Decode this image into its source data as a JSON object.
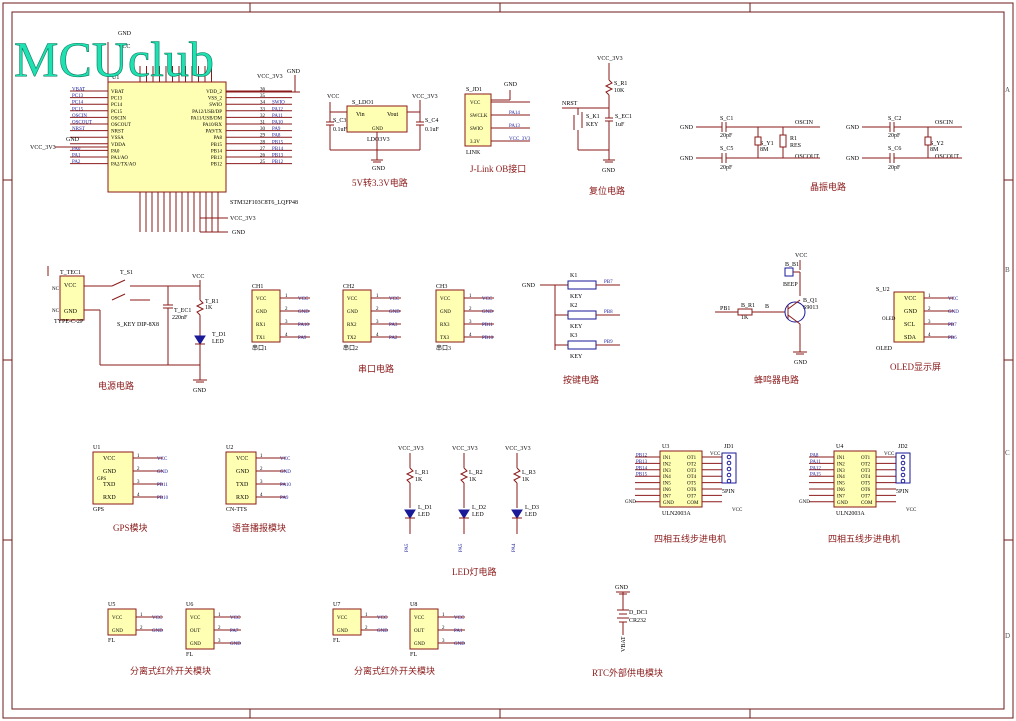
{
  "logo": "MCUclub",
  "border_marks": {
    "rows": [
      "A",
      "B",
      "C",
      "D"
    ]
  },
  "mcu": {
    "ref": "U1",
    "part": "STM32F103C8T6_LQFP48",
    "left_pins": [
      "VBAT",
      "PC13",
      "PC14",
      "PC15",
      "OSCIN",
      "OSCOUT",
      "NRST",
      "VSSA",
      "VDDA",
      "PA0",
      "PA1/AO",
      "PA2/TX/AO"
    ],
    "left_nets": [
      "VBAT",
      "PC13",
      "PC14",
      "PC15",
      "OSCIN",
      "OSCOUT",
      "NRST",
      "",
      "",
      "PA0",
      "PA1",
      "PA2"
    ],
    "right_pins": [
      "VDD_2",
      "VSS_2",
      "SWIO",
      "PA12/USB/DP",
      "PA11/USB/DM",
      "PA10/RX",
      "PA9/TX",
      "PA8",
      "PB15",
      "PB14",
      "PB13",
      "PB12"
    ],
    "right_nets": [
      "",
      "",
      "SWIO",
      "PA12",
      "PA11",
      "PA10",
      "PA9",
      "PA8",
      "PB15",
      "PB14",
      "PB13",
      "PB12"
    ],
    "right_nums": [
      "36",
      "35",
      "34",
      "33",
      "32",
      "31",
      "30",
      "29",
      "28",
      "27",
      "26",
      "25"
    ],
    "vcc_left": "VCC_3V3",
    "vcc_right": "VCC_3V3",
    "gnd": "GND",
    "vcc": "VCC",
    "vcc_bottom": "VCC_3V3"
  },
  "ldo": {
    "ref": "S_LDO1",
    "part": "LDO3V3",
    "vin": "Vin",
    "vout": "Vout",
    "gnd_pin": "GND",
    "vcc": "VCC",
    "vcc_out": "VCC_3V3",
    "c3": "S_C3",
    "c3_val": "0.1uF",
    "c4": "S_C4",
    "c4_val": "0.1uF",
    "gnd": "GND",
    "title": "5V转3.3V电路"
  },
  "jlink": {
    "ref": "S_JD1",
    "part": "LINK",
    "pins": [
      "VCC",
      "SWCLK",
      "SWIO",
      "3.3V"
    ],
    "nets": [
      "",
      "PA14",
      "PA13",
      "VCC_3V3"
    ],
    "gnd": "GND",
    "title": "J-Link OB接口"
  },
  "reset": {
    "vcc": "VCC_3V3",
    "r": "S_R1",
    "r_val": "10K",
    "net": "NRST",
    "key": "S_K1",
    "key_part": "KEY",
    "cap": "S_EC1",
    "cap_val": "1uF",
    "gnd": "GND",
    "title": "复位电路"
  },
  "crystal1": {
    "c1": "S_C1",
    "c1_val": "20pF",
    "c2": "S_C5",
    "c2_val": "20pF",
    "y": "S_Y1",
    "y_val": "8M",
    "r": "R1",
    "r_val": "RES",
    "net1": "OSCIN",
    "net2": "OSCOUT",
    "gnd": "GND",
    "title": "晶振电路"
  },
  "crystal2": {
    "c1": "S_C2",
    "c1_val": "20pF",
    "c2": "S_C6",
    "c2_val": "20pF",
    "y": "S_Y2",
    "y_val": "8M",
    "net1": "OSCIN",
    "net2": "OSCOUT",
    "gnd": "GND"
  },
  "power": {
    "conn": "T_TEC1",
    "conn_part": "TYPE-C-2P",
    "pins": [
      "VCC",
      "GND"
    ],
    "nc": "NC",
    "sw": "T_S1",
    "sw_part": "S_KEY DIP-8X8",
    "cap": "T_EC1",
    "cap_val": "220nF",
    "r": "T_R1",
    "r_val": "1K",
    "led": "T_D1",
    "led_part": "LED",
    "vcc": "VCC",
    "gnd": "GND",
    "title": "电源电路"
  },
  "serial": {
    "title": "串口电路",
    "ports": [
      {
        "ref": "CH1",
        "part": "串口1",
        "pins": [
          "VCC",
          "GND",
          "RX1",
          "TX1"
        ],
        "nets": [
          "VCC",
          "GND",
          "PA10",
          "PA9"
        ]
      },
      {
        "ref": "CH2",
        "part": "串口2",
        "pins": [
          "VCC",
          "GND",
          "RX2",
          "TX2"
        ],
        "nets": [
          "VCC",
          "GND",
          "PA3",
          "PA2"
        ]
      },
      {
        "ref": "CH3",
        "part": "串口3",
        "pins": [
          "VCC",
          "GND",
          "RX3",
          "TX3"
        ],
        "nets": [
          "VCC",
          "GND",
          "PB11",
          "PB10"
        ]
      }
    ]
  },
  "keys": {
    "gnd": "GND",
    "items": [
      {
        "ref": "K1",
        "part": "KEY",
        "net": "PB7"
      },
      {
        "ref": "K2",
        "part": "KEY",
        "net": "PB8"
      },
      {
        "ref": "K3",
        "part": "KEY",
        "net": "PB9"
      }
    ],
    "title": "按键电路"
  },
  "buzzer": {
    "ref": "B_B1",
    "part": "BEEP",
    "q": "B_Q1",
    "q_part": "S9013",
    "r": "B_R1",
    "r_val": "1K",
    "net": "PB1",
    "b": "B",
    "vcc": "VCC",
    "gnd": "GND",
    "title": "蜂鸣器电路"
  },
  "oled": {
    "ref": "S_U2",
    "part": "OLED",
    "pins": [
      "VCC",
      "GND",
      "SCL",
      "SDA"
    ],
    "nets": [
      "VCC",
      "GND",
      "PB7",
      "PB6"
    ],
    "side": "OLED",
    "title": "OLED显示屏"
  },
  "gps": {
    "ref": "U1",
    "part": "GPS",
    "side": "GPS",
    "pins": [
      "VCC",
      "GND",
      "TXD",
      "RXD"
    ],
    "nets": [
      "VCC",
      "GND",
      "PB11",
      "PB10"
    ],
    "title": "GPS模块"
  },
  "voice": {
    "ref": "U2",
    "part": "CN-TTS",
    "pins": [
      "VCC",
      "GND",
      "TXD",
      "RXD"
    ],
    "nets": [
      "VCC",
      "GND",
      "PA10",
      "PA9"
    ],
    "title": "语音播报模块"
  },
  "leds": {
    "title": "LED灯电路",
    "items": [
      {
        "vcc": "VCC_3V3",
        "r": "L_R1",
        "r_val": "1K",
        "d": "L_D1",
        "d_part": "LED",
        "net": "PA5"
      },
      {
        "vcc": "VCC_3V3",
        "r": "L_R2",
        "r_val": "1K",
        "d": "L_D2",
        "d_part": "LED",
        "net": "PA5"
      },
      {
        "vcc": "VCC_3V3",
        "r": "L_R3",
        "r_val": "1K",
        "d": "L_D3",
        "d_part": "LED",
        "net": "PA4"
      }
    ]
  },
  "stepper1": {
    "ref": "U3",
    "part": "ULN2003A",
    "jd": "JD1",
    "jd_part": "5PIN",
    "in_pins": [
      "IN1",
      "IN2",
      "IN3",
      "IN4",
      "IN5",
      "IN6",
      "IN7",
      "GND"
    ],
    "out_pins": [
      "OT1",
      "OT2",
      "OT3",
      "OT4",
      "OT5",
      "OT6",
      "OT7",
      "COM"
    ],
    "nets": [
      "PB12",
      "PB13",
      "PB14",
      "PB15"
    ],
    "vcc": "VCC",
    "gnd": "GND",
    "title": "四相五线步进电机"
  },
  "stepper2": {
    "ref": "U4",
    "part": "ULN2003A",
    "jd": "JD2",
    "jd_part": "5PIN",
    "in_pins": [
      "IN1",
      "IN2",
      "IN3",
      "IN4",
      "IN5",
      "IN6",
      "IN7",
      "GND"
    ],
    "out_pins": [
      "OT1",
      "OT2",
      "OT3",
      "OT4",
      "OT5",
      "OT6",
      "OT7",
      "COM"
    ],
    "nets": [
      "PA8",
      "PA11",
      "PA12",
      "PA15"
    ],
    "vcc": "VCC",
    "gnd": "GND",
    "title": "四相五线步进电机"
  },
  "ir1": {
    "a": {
      "ref": "U5",
      "part": "FL",
      "pins": [
        "VCC",
        "GND"
      ],
      "nets": [
        "VCC",
        "GND"
      ]
    },
    "b": {
      "ref": "U6",
      "part": "FL",
      "pins": [
        "VCC",
        "OUT",
        "GND"
      ],
      "nets": [
        "VCC",
        "PA7",
        "GND"
      ]
    },
    "title": "分离式红外开关模块"
  },
  "ir2": {
    "a": {
      "ref": "U7",
      "part": "FL",
      "pins": [
        "VCC",
        "GND"
      ],
      "nets": [
        "VCC",
        "GND"
      ]
    },
    "b": {
      "ref": "U8",
      "part": "FL",
      "pins": [
        "VCC",
        "OUT",
        "GND"
      ],
      "nets": [
        "VCC",
        "PA1",
        "GND"
      ]
    },
    "title": "分离式红外开关模块"
  },
  "rtc": {
    "gnd": "GND",
    "ref": "D_DC1",
    "part": "CR232",
    "net": "VBAT",
    "title": "RTC外部供电模块"
  }
}
